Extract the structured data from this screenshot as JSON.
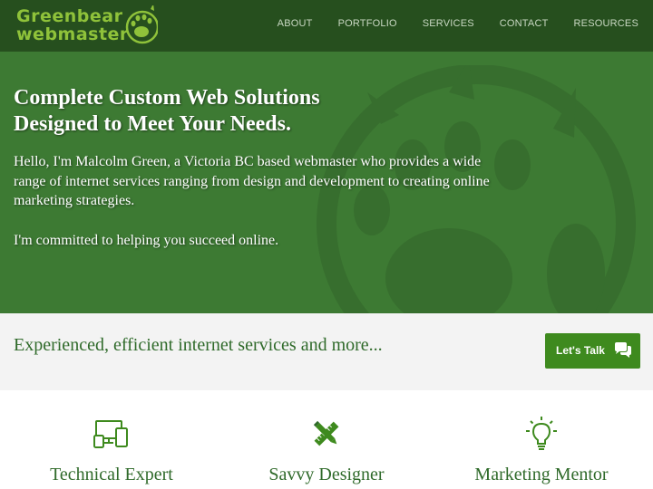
{
  "brand": {
    "line1": "Greenbear",
    "line2": "webmaster",
    "logo_icon": "bear-paw-icon",
    "color": "#8fc23a"
  },
  "nav": {
    "items": [
      {
        "label": "ABOUT"
      },
      {
        "label": "PORTFOLIO"
      },
      {
        "label": "SERVICES"
      },
      {
        "label": "CONTACT"
      },
      {
        "label": "RESOURCES"
      }
    ]
  },
  "hero": {
    "title_line1": "Complete Custom Web Solutions",
    "title_line2": "Designed to Meet Your Needs.",
    "paragraph1": "Hello, I'm Malcolm Green, a Victoria BC based webmaster who provides a wide range of internet services ranging from design and development to creating online marketing strategies.",
    "paragraph2": "I'm committed to helping you succeed online.",
    "background_color": "#3d7a33",
    "watermark_icon": "bear-paw-icon"
  },
  "band": {
    "text": "Experienced, efficient internet services and more...",
    "button_label": "Let's Talk",
    "button_icon": "chat-bubbles-icon",
    "button_color": "#3e8a1e"
  },
  "features": [
    {
      "title": "Technical Expert",
      "icon": "devices-icon"
    },
    {
      "title": "Savvy Designer",
      "icon": "pencil-ruler-icon"
    },
    {
      "title": "Marketing Mentor",
      "icon": "lightbulb-icon"
    }
  ],
  "colors": {
    "header_bg": "#264f1e",
    "accent_green": "#3e8a1e",
    "text_green": "#2f6a2a"
  }
}
